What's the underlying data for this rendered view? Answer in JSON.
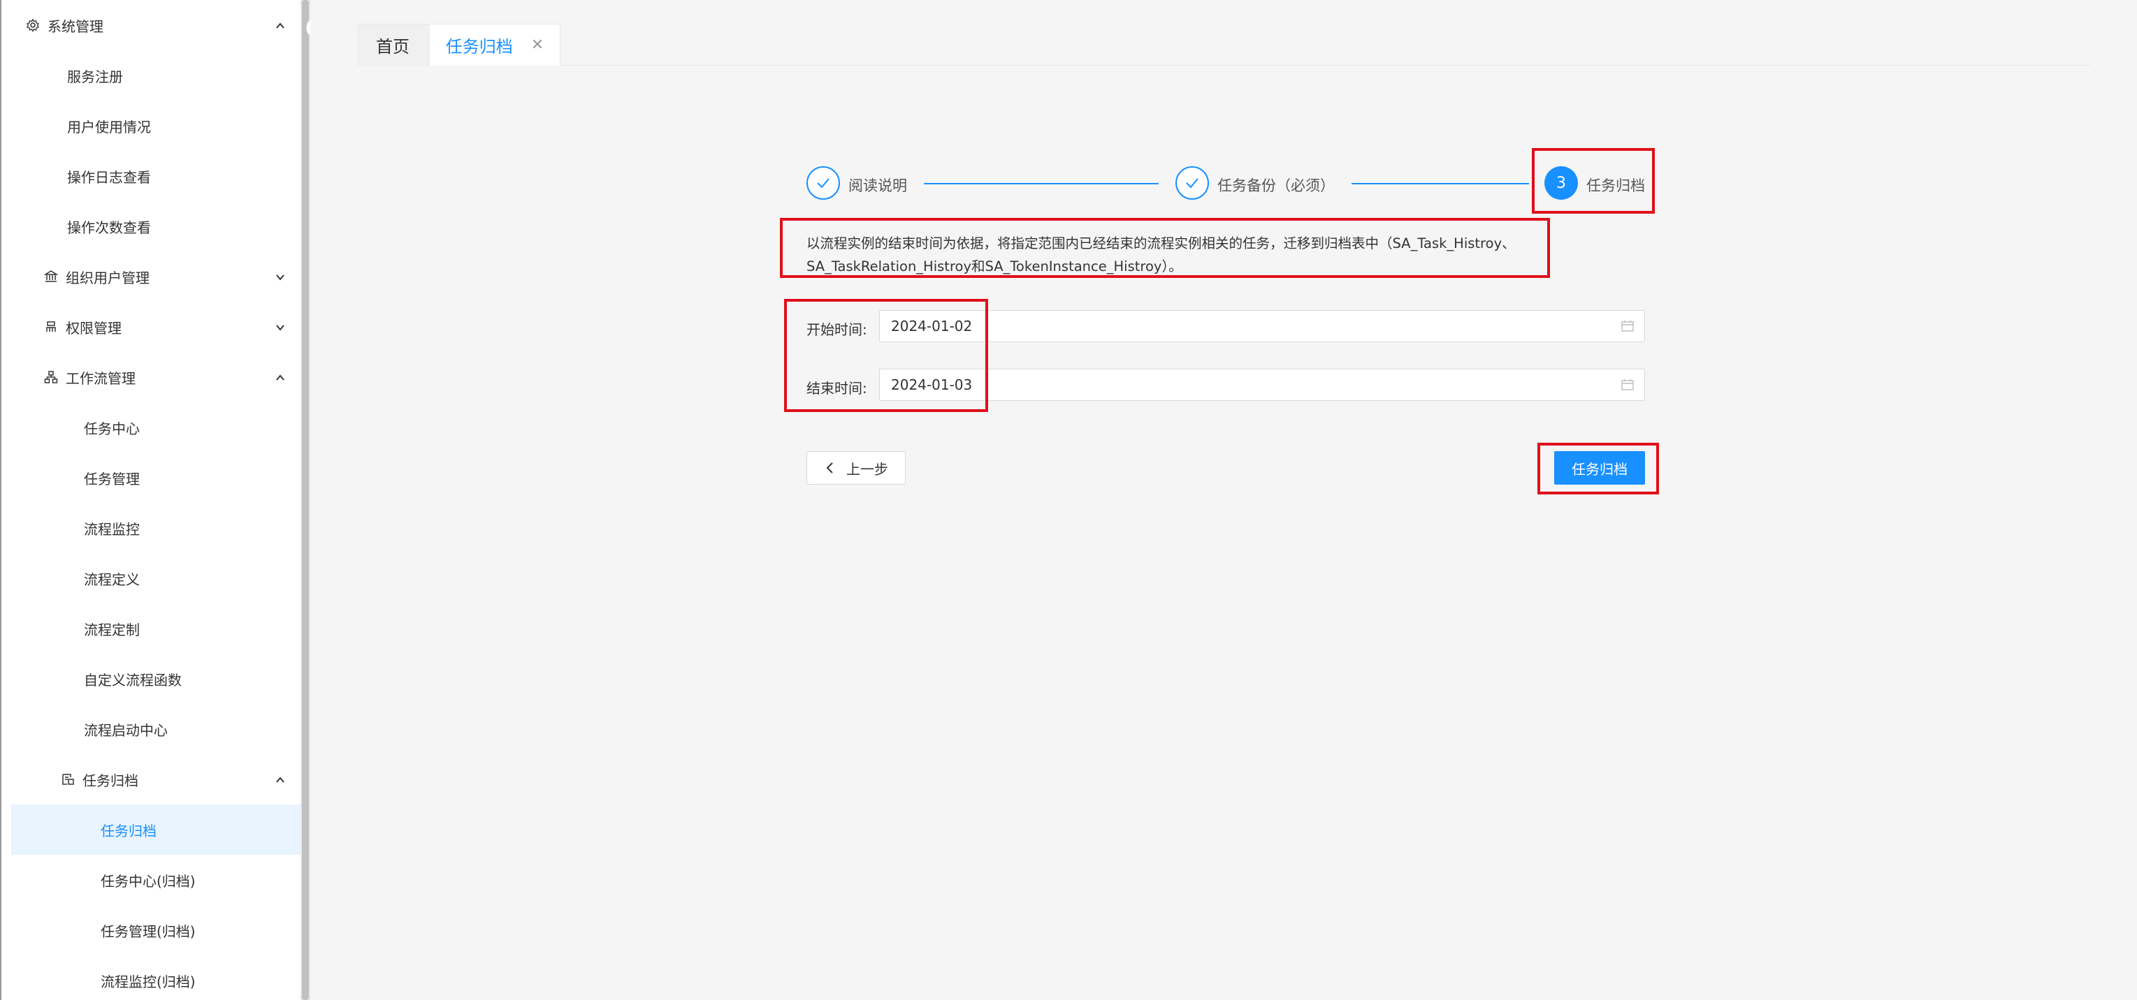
{
  "sidebar": {
    "items": [
      {
        "label": "系统管理",
        "icon": "gear-icon",
        "chevron": "up"
      },
      {
        "label": "服务注册"
      },
      {
        "label": "用户使用情况"
      },
      {
        "label": "操作日志查看"
      },
      {
        "label": "操作次数查看"
      },
      {
        "label": "组织用户管理",
        "icon": "bank-icon",
        "chevron": "down"
      },
      {
        "label": "权限管理",
        "icon": "user-permission-icon",
        "chevron": "down"
      },
      {
        "label": "工作流管理",
        "icon": "workflow-icon",
        "chevron": "up"
      },
      {
        "label": "任务中心"
      },
      {
        "label": "任务管理"
      },
      {
        "label": "流程监控"
      },
      {
        "label": "流程定义"
      },
      {
        "label": "流程定制"
      },
      {
        "label": "自定义流程函数"
      },
      {
        "label": "流程启动中心"
      },
      {
        "label": "任务归档",
        "icon": "archive-icon",
        "chevron": "up"
      },
      {
        "label": "任务归档",
        "active": true
      },
      {
        "label": "任务中心(归档)"
      },
      {
        "label": "任务管理(归档)"
      },
      {
        "label": "流程监控(归档)"
      }
    ]
  },
  "tabs": [
    {
      "label": "首页"
    },
    {
      "label": "任务归档",
      "active": true,
      "close": "✕"
    }
  ],
  "steps": [
    {
      "title": "阅读说明",
      "status": "done"
    },
    {
      "title": "任务备份（必须）",
      "status": "done"
    },
    {
      "title": "任务归档",
      "status": "current",
      "number": "3"
    }
  ],
  "description": {
    "line1": "以流程实例的结束时间为依据，将指定范围内已经结束的流程实例相关的任务，迁移到归档表中（SA_Task_Histroy、",
    "line2": "SA_TaskRelation_Histroy和SA_TokenInstance_Histroy）。"
  },
  "form": {
    "start_label": "开始时间:",
    "start_value": "2024-01-02",
    "end_label": "结束时间:",
    "end_value": "2024-01-03"
  },
  "buttons": {
    "prev_label": "上一步",
    "archive_label": "任务归档"
  },
  "colors": {
    "accent": "#1890ff",
    "highlight": "#e0101a"
  }
}
